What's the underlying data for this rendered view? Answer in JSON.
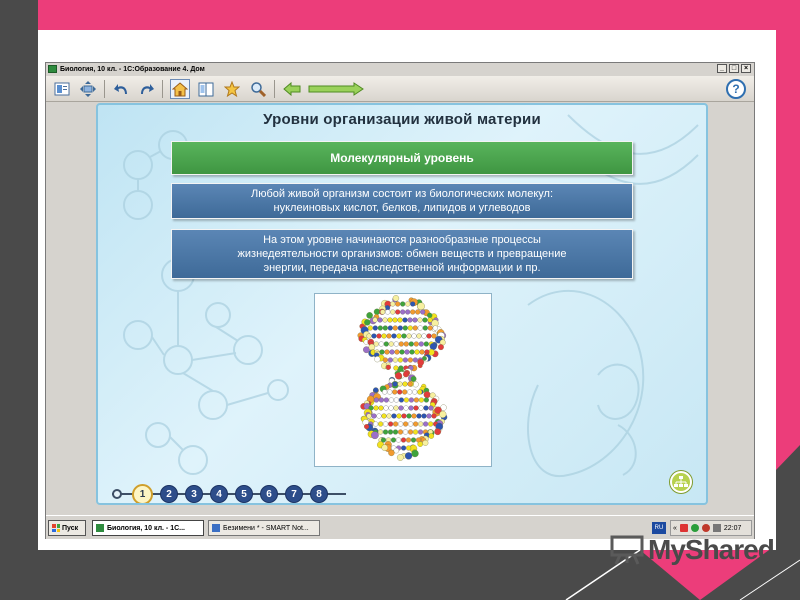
{
  "window": {
    "title": "Биология, 10 кл. - 1С:Образование 4. Дом",
    "buttons": [
      "_",
      "□",
      "×"
    ]
  },
  "toolbar": {
    "help_label": "?"
  },
  "slide": {
    "title": "Уровни организации живой материи",
    "level_heading": "Молекулярный уровень",
    "text1_lines": [
      "Любой живой организм состоит из биологических молекул:",
      "нуклеиновых кислот, белков, липидов и углеводов"
    ],
    "text2_lines": [
      "На этом уровне начинаются разнообразные процессы",
      "жизнедеятельности организмов: обмен веществ и превращение",
      "энергии, передача наследственной информации и пр."
    ],
    "nav_pages": [
      "1",
      "2",
      "3",
      "4",
      "5",
      "6",
      "7",
      "8"
    ],
    "active_page": "1"
  },
  "taskbar": {
    "start_label": "Пуск",
    "tasks": [
      {
        "label": "Биология, 10 кл. - 1С...",
        "active": true
      },
      {
        "label": "Безимени * - SMART Not...",
        "active": false
      }
    ],
    "lang": "RU",
    "tray_arrows": "«",
    "clock": "22:07"
  },
  "watermark": {
    "text": "MyShared"
  },
  "colors": {
    "background": "#ec3d7a",
    "dark_frame": "#4a4a4a",
    "heading_green": "#4aa24d",
    "text_blue": "#4a77a6"
  },
  "icons": [
    "contents-icon",
    "fit-icon",
    "undo-icon",
    "redo-icon",
    "home-icon",
    "book-icon",
    "star-icon",
    "search-icon",
    "back-arrow-icon",
    "forward-arrow-icon",
    "help-icon",
    "map-icon"
  ]
}
